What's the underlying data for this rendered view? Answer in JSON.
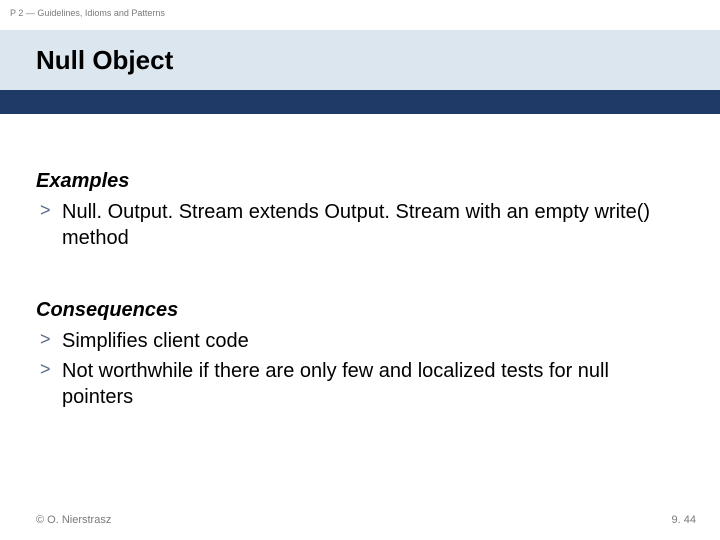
{
  "breadcrumb": "P 2 — Guidelines, Idioms and Patterns",
  "title": "Null Object",
  "sections": {
    "examples": {
      "heading": "Examples",
      "items": [
        "Null. Output. Stream extends Output. Stream with an empty write() method"
      ]
    },
    "consequences": {
      "heading": "Consequences",
      "items": [
        "Simplifies client code",
        "Not worthwhile if there are only few and localized tests for null pointers"
      ]
    }
  },
  "bullet_marker": ">",
  "copyright": "© O. Nierstrasz",
  "page_number": "9. 44"
}
